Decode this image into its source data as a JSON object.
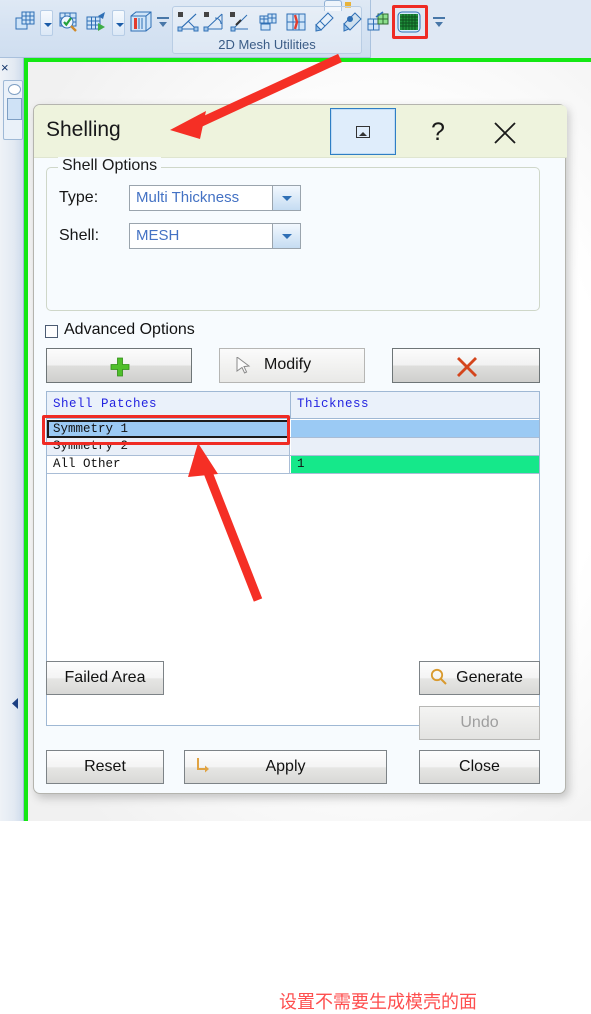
{
  "ribbon": {
    "groups": [
      {
        "name": "mesh-tools-group",
        "label": ""
      },
      {
        "name": "2d-mesh-utilities-group",
        "label": "2D Mesh Utilities"
      }
    ],
    "left_icons": [
      "mesh-create-icon",
      "mesh-create-dropdown",
      "mesh-check-icon",
      "mesh-export-icon",
      "mesh-export-dropdown",
      "mesh-volume-icon",
      "mesh-overflow-icon"
    ],
    "utility_icons": [
      "split-edge-icon",
      "swap-edge-icon",
      "collapse-edge-icon",
      "remesh-patch-icon",
      "split-patch-icon",
      "smooth-mesh-icon",
      "refine-mesh-icon",
      "project-mesh-icon",
      "shelling-icon",
      "utilities-overflow-icon"
    ],
    "highlighted_icon": "shelling-icon"
  },
  "left_dock": {
    "close_label": "×",
    "collapse_arrow": "collapse-left-arrow-icon"
  },
  "dialog": {
    "title": "Shelling",
    "title_buttons": [
      {
        "name": "pin-button",
        "label": "",
        "icon": "collapse-panel-icon",
        "active": true
      },
      {
        "name": "help-button",
        "label": "?",
        "icon": "question-mark-icon",
        "active": false
      },
      {
        "name": "close-button",
        "label": "",
        "icon": "close-x-icon",
        "active": false
      }
    ],
    "shell_options": {
      "legend": "Shell Options",
      "fields": [
        {
          "label": "Type:",
          "value": "Multi Thickness",
          "name": "type-combo"
        },
        {
          "label": "Shell:",
          "value": "MESH",
          "name": "shell-combo"
        }
      ]
    },
    "advanced_options": {
      "label": "Advanced Options",
      "checked": false
    },
    "action_buttons": [
      {
        "name": "add-patch-button",
        "label": "",
        "icon": "plus-icon"
      },
      {
        "name": "modify-patch-button",
        "label": "Modify",
        "icon": "cursor-arrow-icon"
      },
      {
        "name": "delete-patch-button",
        "label": "",
        "icon": "red-x-icon"
      }
    ],
    "table": {
      "columns": [
        "Shell Patches",
        "Thickness"
      ],
      "rows": [
        {
          "patch": "Symmetry 1",
          "thickness": "",
          "selected": true,
          "thickness_highlight": "none"
        },
        {
          "patch": "Symmetry 2",
          "thickness": "",
          "selected": false,
          "thickness_highlight": "none"
        },
        {
          "patch": "All Other",
          "thickness": "1",
          "selected": false,
          "thickness_highlight": "green"
        }
      ]
    },
    "annotation": {
      "text": "设置不需要生成模壳的面",
      "color": "#fe4f4f"
    },
    "bottom_buttons": [
      {
        "name": "failed-area-button",
        "label": "Failed Area",
        "icon": "",
        "disabled": false
      },
      {
        "name": "generate-button",
        "label": "Generate",
        "icon": "magnifier-icon",
        "disabled": false
      },
      {
        "name": "undo-button",
        "label": "Undo",
        "icon": "",
        "disabled": true
      },
      {
        "name": "reset-button",
        "label": "Reset",
        "icon": "",
        "disabled": false
      },
      {
        "name": "apply-button",
        "label": "Apply",
        "icon": "apply-arrow-icon",
        "disabled": false
      },
      {
        "name": "close-bottom-button",
        "label": "Close",
        "icon": "",
        "disabled": false
      }
    ]
  },
  "colors": {
    "title_bar": "#eef3dd",
    "selection_blue": "#9bcaf4",
    "thickness_green": "#15e88a",
    "annotation_red": "#fe4f4f",
    "highlight_red": "#ef2b24",
    "viewport_green": "#14e814",
    "combo_text_blue": "#4472c4",
    "table_header_blue": "#2323e0"
  }
}
